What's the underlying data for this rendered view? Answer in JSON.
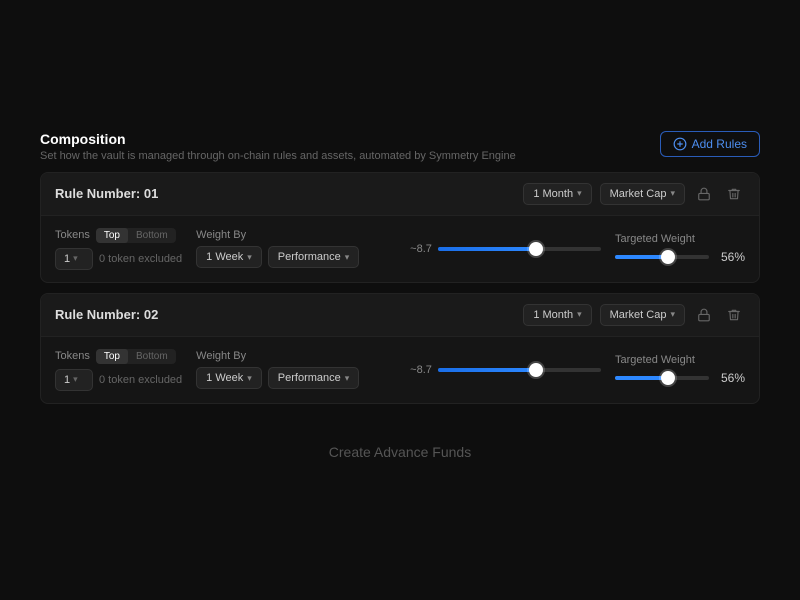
{
  "composition": {
    "title": "Composition",
    "subtitle": "Set how the vault is managed through on-chain rules and assets, automated by Symmetry Engine",
    "add_rules_label": "Add Rules"
  },
  "rules": [
    {
      "id": "rule-01",
      "number_label": "Rule Number: 01",
      "period": "1 Month",
      "sort": "Market Cap",
      "tokens": {
        "label": "Tokens",
        "count": "1",
        "top_label": "Top",
        "bottom_label": "Bottom",
        "active_tab": "Top",
        "excluded": "0 token excluded"
      },
      "weight_by": {
        "label": "Weight By",
        "period": "1 Week",
        "method": "Performance"
      },
      "slider": {
        "value_label": "~8.7",
        "fill_percent": 60
      },
      "targeted_weight": {
        "label": "Targeted Weight",
        "fill_percent": 56,
        "thumb_percent": 56,
        "value": "56%"
      }
    },
    {
      "id": "rule-02",
      "number_label": "Rule Number: 02",
      "period": "1 Month",
      "sort": "Market Cap",
      "tokens": {
        "label": "Tokens",
        "count": "1",
        "top_label": "Top",
        "bottom_label": "Bottom",
        "active_tab": "Top",
        "excluded": "0 token excluded"
      },
      "weight_by": {
        "label": "Weight By",
        "period": "1 Week",
        "method": "Performance"
      },
      "slider": {
        "value_label": "~8.7",
        "fill_percent": 60
      },
      "targeted_weight": {
        "label": "Targeted Weight",
        "fill_percent": 56,
        "thumb_percent": 56,
        "value": "56%"
      }
    }
  ],
  "bottom": {
    "create_label": "Create Advance Funds"
  },
  "colors": {
    "accent": "#2d88ff",
    "bg_card": "#151515",
    "bg_header": "#1a1a1a"
  }
}
